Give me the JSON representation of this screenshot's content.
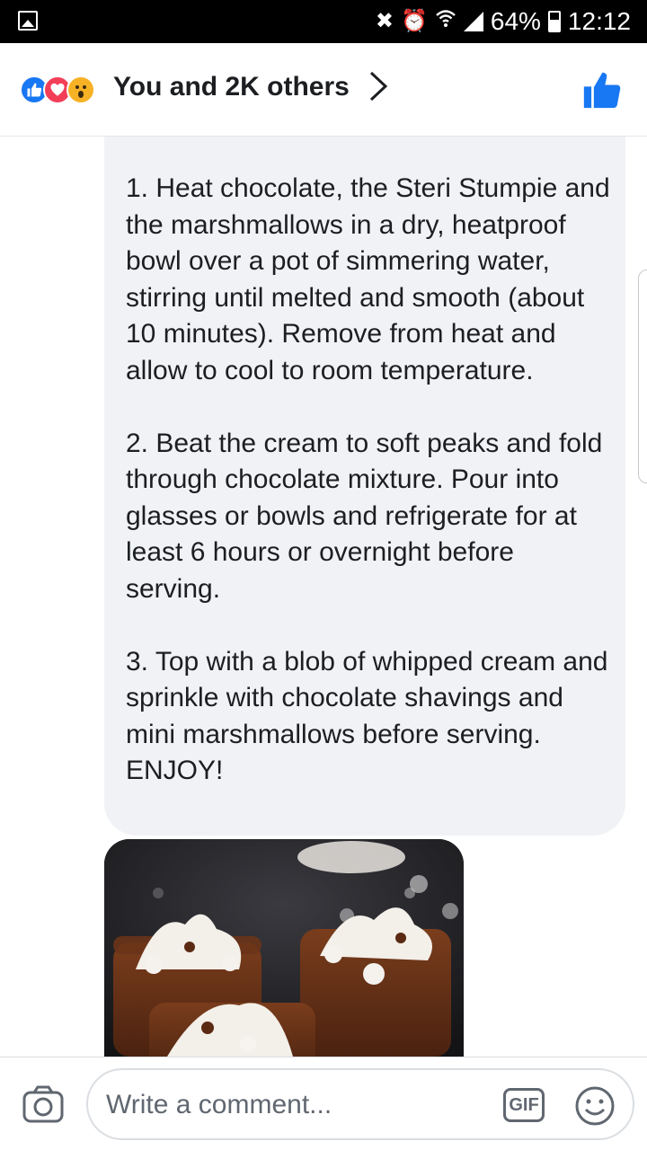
{
  "status_bar": {
    "battery": "64%",
    "time": "12:12"
  },
  "header": {
    "title": "You and 2K others",
    "reactions": [
      "like",
      "love",
      "wow"
    ],
    "chevron_icon": "chevron-right-icon",
    "like_icon": "thumbs-up-icon",
    "accent_color": "#1877f2"
  },
  "comment": {
    "steps": [
      "1. Heat chocolate, the Steri Stumpie and the marshmallows in a dry, heatproof bowl over a pot of simmering water, stirring until melted and smooth (about 10 minutes). Remove from heat and allow to cool to room temperature.",
      "2. Beat the cream to soft peaks and fold through chocolate mixture. Pour into glasses or bowls and refrigerate for at least 6 hours or overnight before serving.",
      "3. Top with a blob of whipped cream and sprinkle with chocolate shavings and mini marshmallows before serving. ENJOY!"
    ]
  },
  "composer": {
    "placeholder": "Write a comment...",
    "gif_label": "GIF",
    "camera_icon": "camera-icon",
    "emoji_icon": "smiley-icon"
  }
}
